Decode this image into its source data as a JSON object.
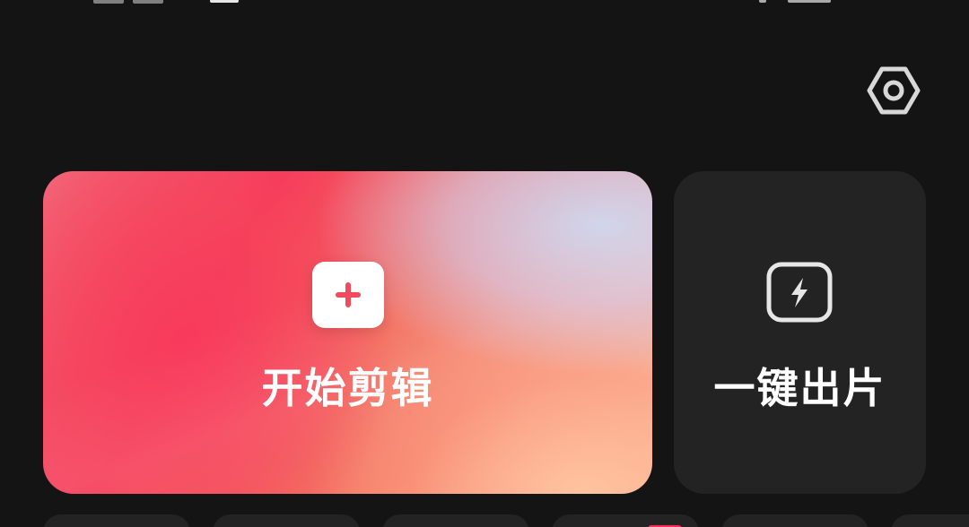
{
  "header": {
    "settings_icon": "settings-hex-icon"
  },
  "cards": {
    "start_edit": {
      "label": "开始剪辑",
      "icon": "plus-icon",
      "accent_color": "#f04a5e"
    },
    "one_click": {
      "label": "一键出片",
      "icon": "lightning-icon"
    }
  },
  "shortcuts": {
    "count": 6
  },
  "colors": {
    "background": "#141414",
    "card_dark": "#232323",
    "badge": "#ff2d55"
  }
}
